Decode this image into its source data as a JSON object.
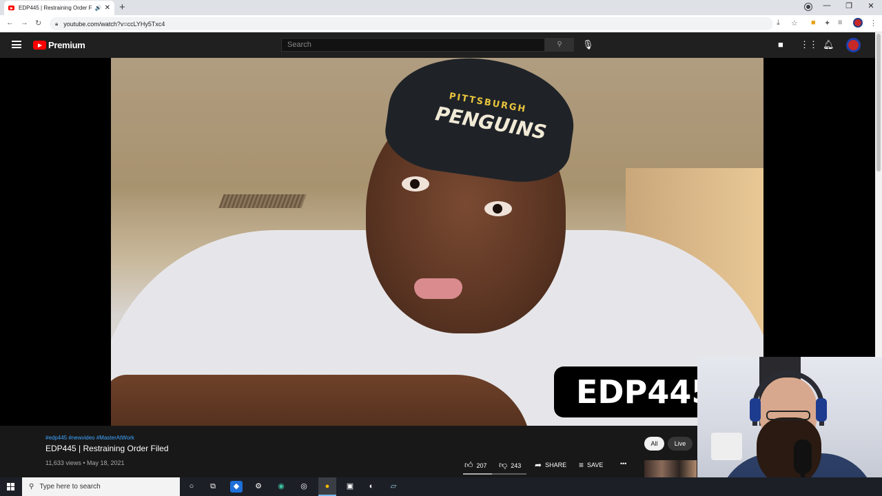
{
  "browser": {
    "tab_title": "EDP445 | Restraining Order F",
    "tab_audio": "🔊",
    "tab_close": "✕",
    "new_tab": "+",
    "url": "youtube.com/watch?v=ccLYHy5Txc4",
    "window_controls": [
      "—",
      "❐",
      "✕"
    ]
  },
  "youtube": {
    "logo_text": "Premium",
    "search_placeholder": "Search",
    "video": {
      "cap_line1": "PITTSBURGH",
      "cap_line2": "PENGUINS",
      "overlay_text": "EDP445"
    },
    "info": {
      "tags": "#edp445 #newvideo #MasterAtWork",
      "title": "EDP445 | Restraining Order Filed",
      "views": "11,633 views • May 18, 2021",
      "likes": "207",
      "dislikes": "243",
      "like_ratio": 0.46,
      "share_label": "SHARE",
      "save_label": "SAVE",
      "more_label": "•••",
      "chips": [
        "All",
        "Live"
      ]
    }
  },
  "taskbar": {
    "search_placeholder": "Type here to search"
  },
  "colors": {
    "youtube_red": "#ff0000",
    "header_bg": "#202020",
    "link_blue": "#3ea6ff"
  }
}
